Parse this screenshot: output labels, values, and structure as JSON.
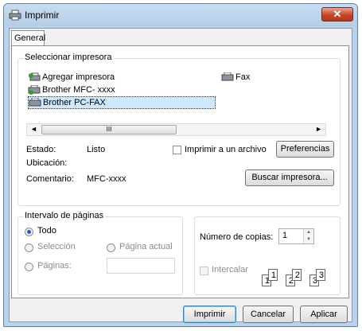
{
  "window": {
    "title": "Imprimir",
    "close": "✕"
  },
  "tabs": [
    "General"
  ],
  "select_printer": {
    "legend": "Seleccionar impresora",
    "printers": [
      "Agregar impresora",
      "Fax",
      "Brother MFC- xxxx",
      "Brother PC-FAX"
    ],
    "scroll_mark": "III",
    "selected": "Brother PC-FAX",
    "status_label": "Estado:",
    "status_value": "Listo",
    "location_label": "Ubicación:",
    "location_value": "",
    "comment_label": "Comentario:",
    "comment_value": "MFC-xxxx",
    "print_to_file_label": "Imprimir a un archivo",
    "print_to_file_checked": false,
    "preferences_button": "Preferencias",
    "find_printer_button": "Buscar impresora..."
  },
  "page_range": {
    "legend": "Intervalo de páginas",
    "all_label": "Todo",
    "selection_label": "Selección",
    "current_page_label": "Página actual",
    "pages_label": "Páginas:",
    "pages_value": "",
    "selected_option": "Todo"
  },
  "copies": {
    "label": "Número de copias:",
    "value": "1",
    "collate_label": "Intercalar",
    "collate_checked": false,
    "collate_page_numbers": [
      "1",
      "1",
      "2",
      "2",
      "3",
      "3"
    ]
  },
  "footer": {
    "print_button": "Imprimir",
    "cancel_button": "Cancelar",
    "apply_button": "Aplicar"
  },
  "colors": {
    "frame": "#b9d1ea",
    "close": "#c7452a",
    "selection": "#cde8ff"
  }
}
